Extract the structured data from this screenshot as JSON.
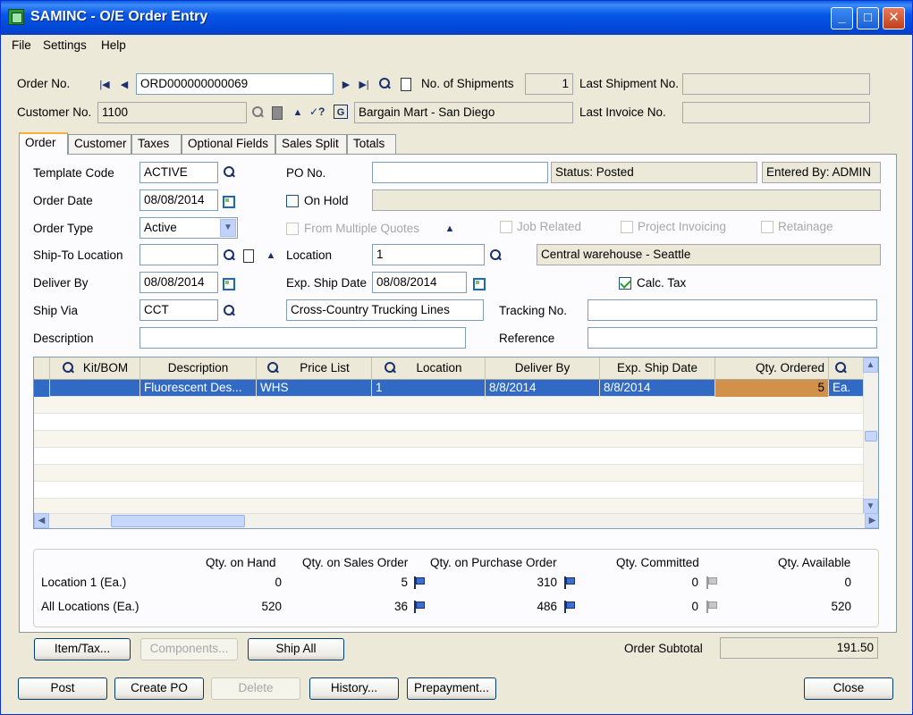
{
  "window": {
    "title": "SAMINC - O/E Order Entry"
  },
  "menu": {
    "file": "File",
    "settings": "Settings",
    "help": "Help"
  },
  "header": {
    "order_no_label": "Order No.",
    "order_no": "ORD000000000069",
    "shipments_label": "No. of Shipments",
    "shipments": "1",
    "last_shipment_label": "Last Shipment No.",
    "last_shipment": "",
    "customer_no_label": "Customer No.",
    "customer_no": "1100",
    "customer_name": "Bargain Mart - San Diego",
    "last_invoice_label": "Last Invoice No.",
    "last_invoice": ""
  },
  "tabs": [
    "Order",
    "Customer",
    "Taxes",
    "Optional Fields",
    "Sales Split",
    "Totals"
  ],
  "order": {
    "template_code_label": "Template Code",
    "template_code": "ACTIVE",
    "po_no_label": "PO No.",
    "po_no": "",
    "status": "Status: Posted",
    "entered_by": "Entered By: ADMIN",
    "order_date_label": "Order Date",
    "order_date": "08/08/2014",
    "on_hold_label": "On Hold",
    "on_hold_desc": "",
    "order_type_label": "Order Type",
    "order_type": "Active",
    "from_multiple_quotes": "From Multiple Quotes",
    "job_related": "Job Related",
    "project_invoicing": "Project Invoicing",
    "retainage": "Retainage",
    "ship_to_label": "Ship-To Location",
    "ship_to": "",
    "location_label": "Location",
    "location": "1",
    "location_desc": "Central warehouse - Seattle",
    "deliver_by_label": "Deliver By",
    "deliver_by": "08/08/2014",
    "exp_ship_label": "Exp. Ship Date",
    "exp_ship": "08/08/2014",
    "calc_tax_label": "Calc. Tax",
    "ship_via_label": "Ship Via",
    "ship_via": "CCT",
    "ship_via_desc": "Cross-Country Trucking Lines",
    "tracking_label": "Tracking No.",
    "tracking": "",
    "description_label": "Description",
    "description": "",
    "reference_label": "Reference",
    "reference": ""
  },
  "grid": {
    "headers": [
      "Kit/BOM",
      "Description",
      "Price List",
      "Location",
      "Deliver By",
      "Exp. Ship Date",
      "Qty. Ordered"
    ],
    "rows": [
      {
        "kit": "",
        "description": "Fluorescent Des...",
        "price_list": "WHS",
        "location": "1",
        "deliver_by": "8/8/2014",
        "exp_ship": "8/8/2014",
        "qty": "5",
        "uom": "Ea."
      }
    ]
  },
  "qty_summary": {
    "headers": [
      "Qty. on Hand",
      "Qty. on Sales Order",
      "Qty. on Purchase Order",
      "Qty. Committed",
      "Qty. Available"
    ],
    "rows": [
      {
        "label": "Location  1 (Ea.)",
        "on_hand": "0",
        "on_sales": "5",
        "on_po": "310",
        "committed": "0",
        "available": "0"
      },
      {
        "label": "All Locations (Ea.)",
        "on_hand": "520",
        "on_sales": "36",
        "on_po": "486",
        "committed": "0",
        "available": "520"
      }
    ]
  },
  "buttons": {
    "item_tax": "Item/Tax...",
    "components": "Components...",
    "ship_all": "Ship All",
    "order_subtotal_label": "Order Subtotal",
    "order_subtotal": "191.50",
    "post": "Post",
    "create_po": "Create PO",
    "delete": "Delete",
    "history": "History...",
    "prepayment": "Prepayment...",
    "close": "Close"
  },
  "colors": {
    "title_bar": "#0245d6",
    "selection": "#316ac5",
    "qty_highlight": "#d2914a"
  }
}
